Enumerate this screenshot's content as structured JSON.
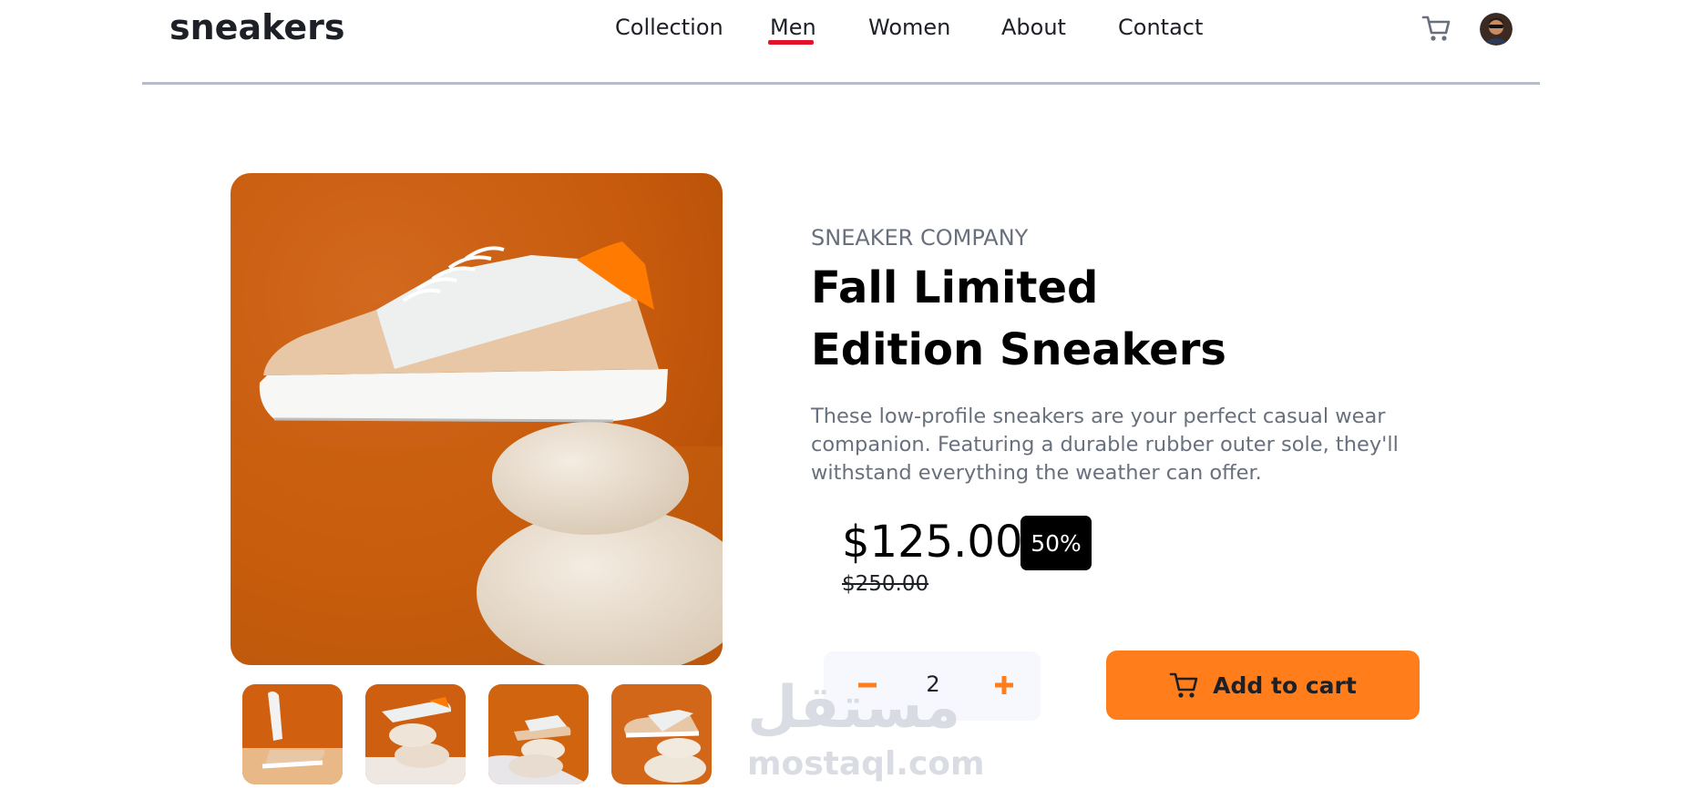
{
  "header": {
    "logo": "sneakers",
    "nav": [
      "Collection",
      "Men",
      "Women",
      "About",
      "Contact"
    ],
    "active_nav": "Men",
    "icons": {
      "cart": "cart-icon",
      "avatar": "user-avatar"
    }
  },
  "product": {
    "company": "SNEAKER COMPANY",
    "title": "Fall Limited Edition Sneakers",
    "description": "These low-profile sneakers are your perfect casual wear companion. Featuring a durable rubber outer sole, they'll withstand everything the weather can offer.",
    "price": "$125.00",
    "discount": "50%",
    "original_price": "$250.00",
    "quantity": "2",
    "add_to_cart_label": "Add to cart"
  },
  "gallery": {
    "thumbnail_count": 4
  },
  "watermark": {
    "arabic": "مستقل",
    "latin": "mostaql.com"
  },
  "colors": {
    "accent": "#ff7e1b",
    "nav_active": "#e3122b",
    "text_dark": "#1d2026",
    "text_muted": "#69707d",
    "badge_bg": "#000000",
    "qty_bg": "#f6f8fd"
  }
}
